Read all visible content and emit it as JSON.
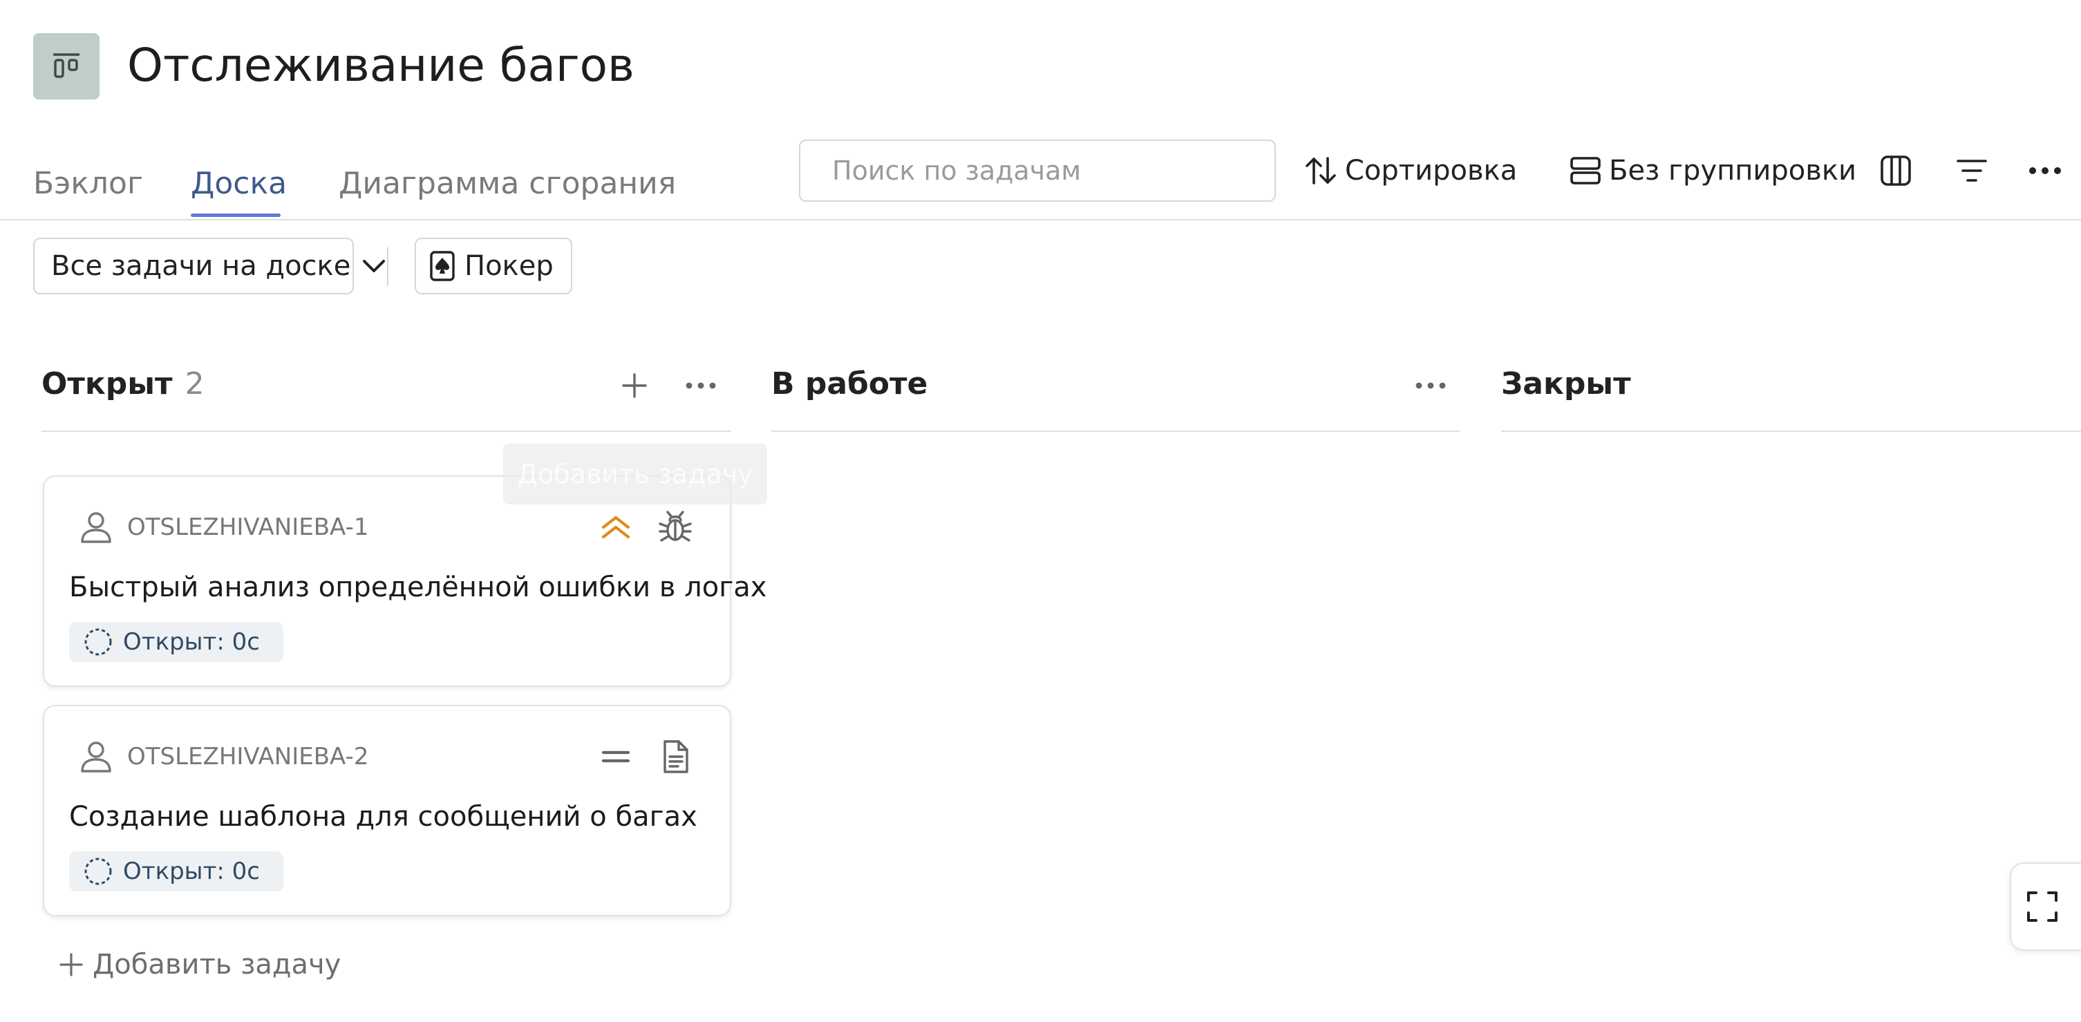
{
  "header": {
    "title": "Отслеживание багов",
    "board_icon": "board-icon"
  },
  "tabs": [
    {
      "label": "Бэклог",
      "active": false
    },
    {
      "label": "Доска",
      "active": true
    },
    {
      "label": "Диаграмма сгорания",
      "active": false
    }
  ],
  "toolbar": {
    "search_placeholder": "Поиск по задачам",
    "sort_label": "Сортировка",
    "sort_icon": "sort-arrows-icon",
    "grouping_label": "Без группировки",
    "grouping_icon": "grouping-icon",
    "columns_icon": "columns-icon",
    "filter_icon": "filter-icon",
    "more_icon": "more-horizontal-icon"
  },
  "filters": {
    "scope_label": "Все задачи на доске",
    "poker_label": "Покер",
    "poker_icon": "poker-card-icon"
  },
  "columns": [
    {
      "title": "Открыт",
      "count": "2"
    },
    {
      "title": "В работе",
      "count": ""
    },
    {
      "title": "Закрыт",
      "count": ""
    }
  ],
  "tooltip": "Добавить задачу",
  "cards": [
    {
      "key": "OTSLEZHIVANIEBA-1",
      "title": "Быстрый анализ определённой ошибки в логах",
      "status": "Открыт: 0с",
      "priority_icon": "priority-high-icon",
      "type_icon": "bug-icon"
    },
    {
      "key": "OTSLEZHIVANIEBA-2",
      "title": "Создание шаблона для сообщений о багах",
      "status": "Открыт: 0с",
      "priority_icon": "priority-normal-icon",
      "type_icon": "document-icon"
    }
  ],
  "add_task_label": "Добавить задачу",
  "colors": {
    "accent": "#5a7ad6",
    "active_tab": "#3d5a8c",
    "priority_high": "#e08a1e",
    "board_icon_bg": "#bfcdcb",
    "status_badge_bg": "#eef1f3",
    "status_text": "#2f4a66"
  }
}
